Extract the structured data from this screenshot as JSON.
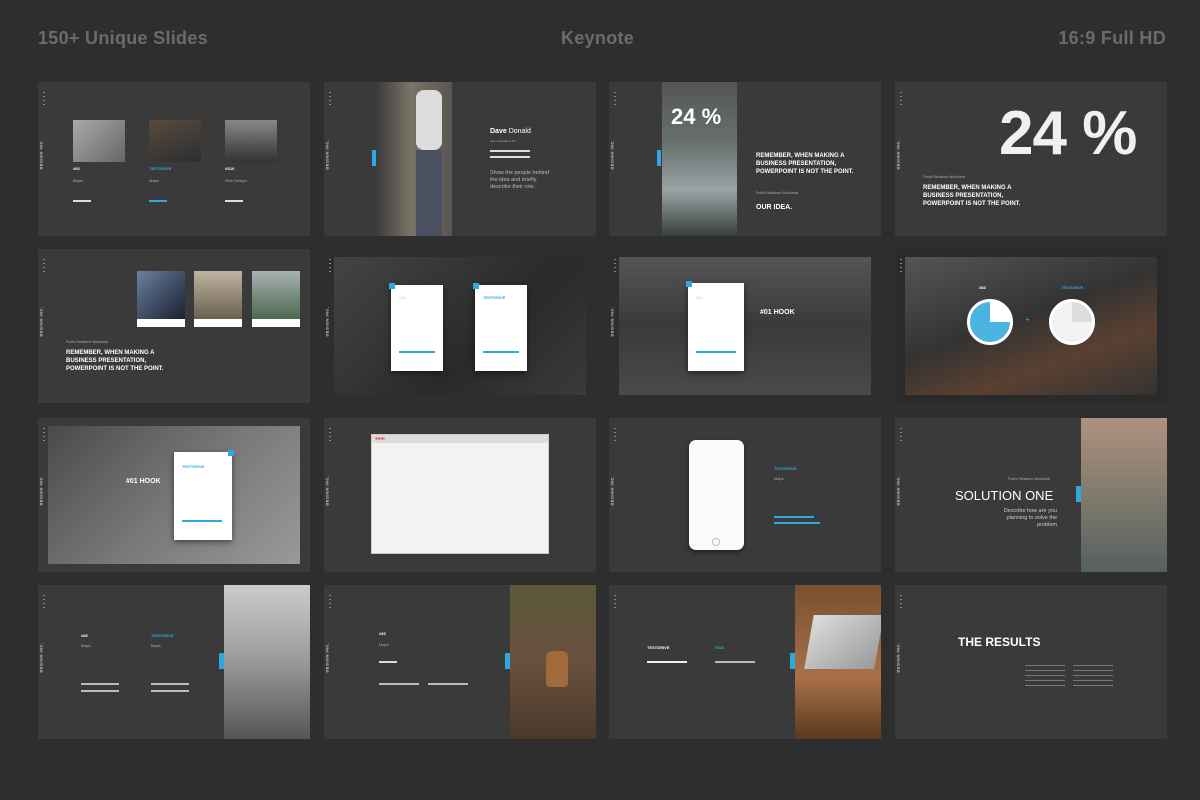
{
  "header": {
    "left": "150+ Unique Slides",
    "center": "Keynote",
    "right": "16:9 Full HD"
  },
  "brand": "DESIGN INC.",
  "s1": {
    "items": [
      {
        "num": "#83",
        "sub": "Maps"
      },
      {
        "num": "TESTDRIVE",
        "sub": "Maps"
      },
      {
        "num": "#S10",
        "sub": "Web Design"
      }
    ]
  },
  "s2": {
    "first": "Dave",
    "last": "Donald",
    "role": "user interface & FX",
    "desc": "Show the people behind the idea and briefly describe their role."
  },
  "s3": {
    "pct": "24 %",
    "text": "REMEMBER, WHEN MAKING A BUSINESS PRESENTATION, POWERPOINT IS NOT THE POINT.",
    "sub": "Public Relations Worldwide",
    "idea": "OUR IDEA."
  },
  "s4": {
    "pct": "24 %",
    "sub": "Public Relations Worldwide",
    "text": "REMEMBER, WHEN MAKING A BUSINESS PRESENTATION, POWERPOINT IS NOT THE POINT."
  },
  "s5": {
    "sub": "Public Relations Worldwide",
    "text": "REMEMBER, WHEN MAKING A BUSINESS PRESENTATION, POWERPOINT IS NOT THE POINT."
  },
  "s6": {
    "card1": "#83",
    "card2": "TESTDRIVE"
  },
  "s7": {
    "card": "#83",
    "hook": "#01 HOOK"
  },
  "s8": {
    "a": "#83",
    "b": "TESTDRIVE"
  },
  "s9": {
    "card": "TESTDRIVE",
    "hook": "#01 HOOK"
  },
  "s11": {
    "label": "TESTDRIVE",
    "sub": "Maps"
  },
  "s12": {
    "title": "SOLUTION ONE",
    "desc": "Describe how are you planning to solve the problem",
    "sub": "Public Relations Worldwide"
  },
  "s13": {
    "a": "#83",
    "b": "TESTDRIVE",
    "sub": "Maps"
  },
  "s14": {
    "a": "#83",
    "sub": "Maps"
  },
  "s15": {
    "a": "TESTDRIVE",
    "b": "#S10"
  },
  "s16": {
    "title": "THE RESULTS"
  }
}
